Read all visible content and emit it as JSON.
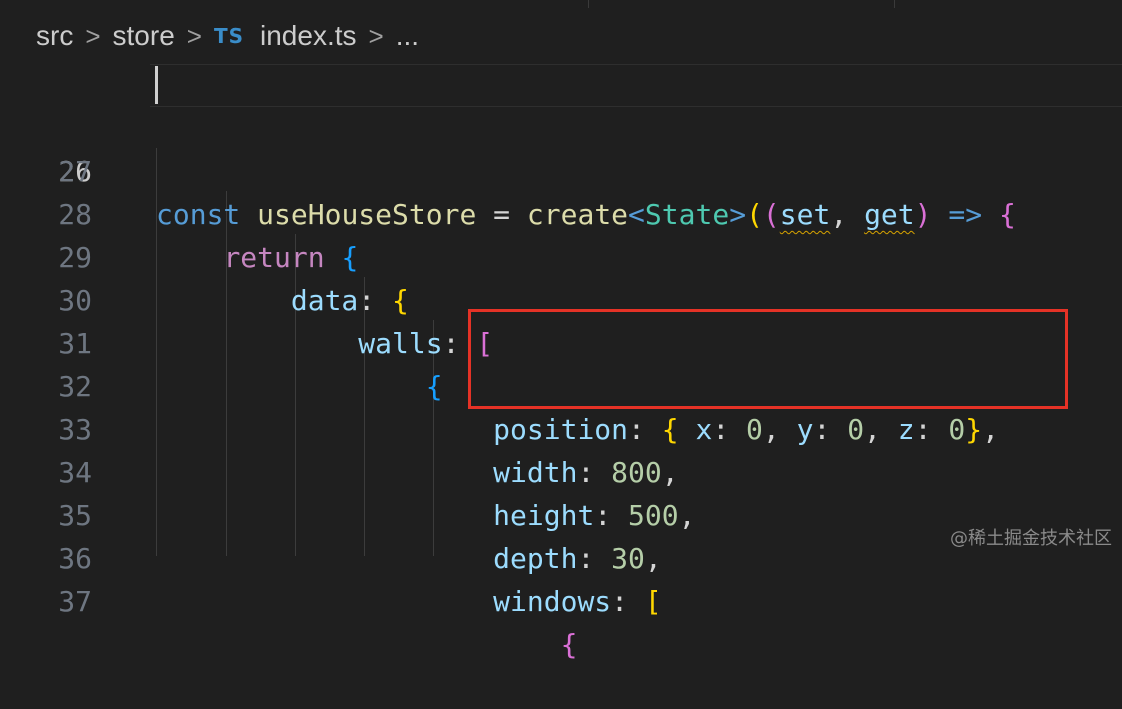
{
  "breadcrumb": {
    "items": [
      "src",
      "store",
      "index.ts",
      "..."
    ],
    "file_badge": "TS",
    "separator": ">"
  },
  "editor": {
    "line_numbers": [
      "26",
      "27",
      "28",
      "29",
      "30",
      "31",
      "32",
      "33",
      "34",
      "35",
      "36",
      "37"
    ],
    "active_line": "26",
    "code": {
      "l27": {
        "const": "const",
        "name": "useHouseStore",
        "eq": "=",
        "create": "create",
        "lt": "<",
        "state": "State",
        "gt": ">",
        "set": "set",
        "get": "get",
        "arrow": "=>"
      },
      "l28": {
        "return": "return"
      },
      "l29": {
        "key": "data"
      },
      "l30": {
        "key": "walls"
      },
      "l32": {
        "key": "position",
        "x": "x",
        "y": "y",
        "z": "z",
        "xv": "0",
        "yv": "0",
        "zv": "0"
      },
      "l33": {
        "key": "width",
        "val": "800"
      },
      "l34": {
        "key": "height",
        "val": "500"
      },
      "l35": {
        "key": "depth",
        "val": "30"
      },
      "l36": {
        "key": "windows"
      }
    },
    "highlight_color": "#e53226"
  },
  "watermark": "@稀土掘金技术社区"
}
